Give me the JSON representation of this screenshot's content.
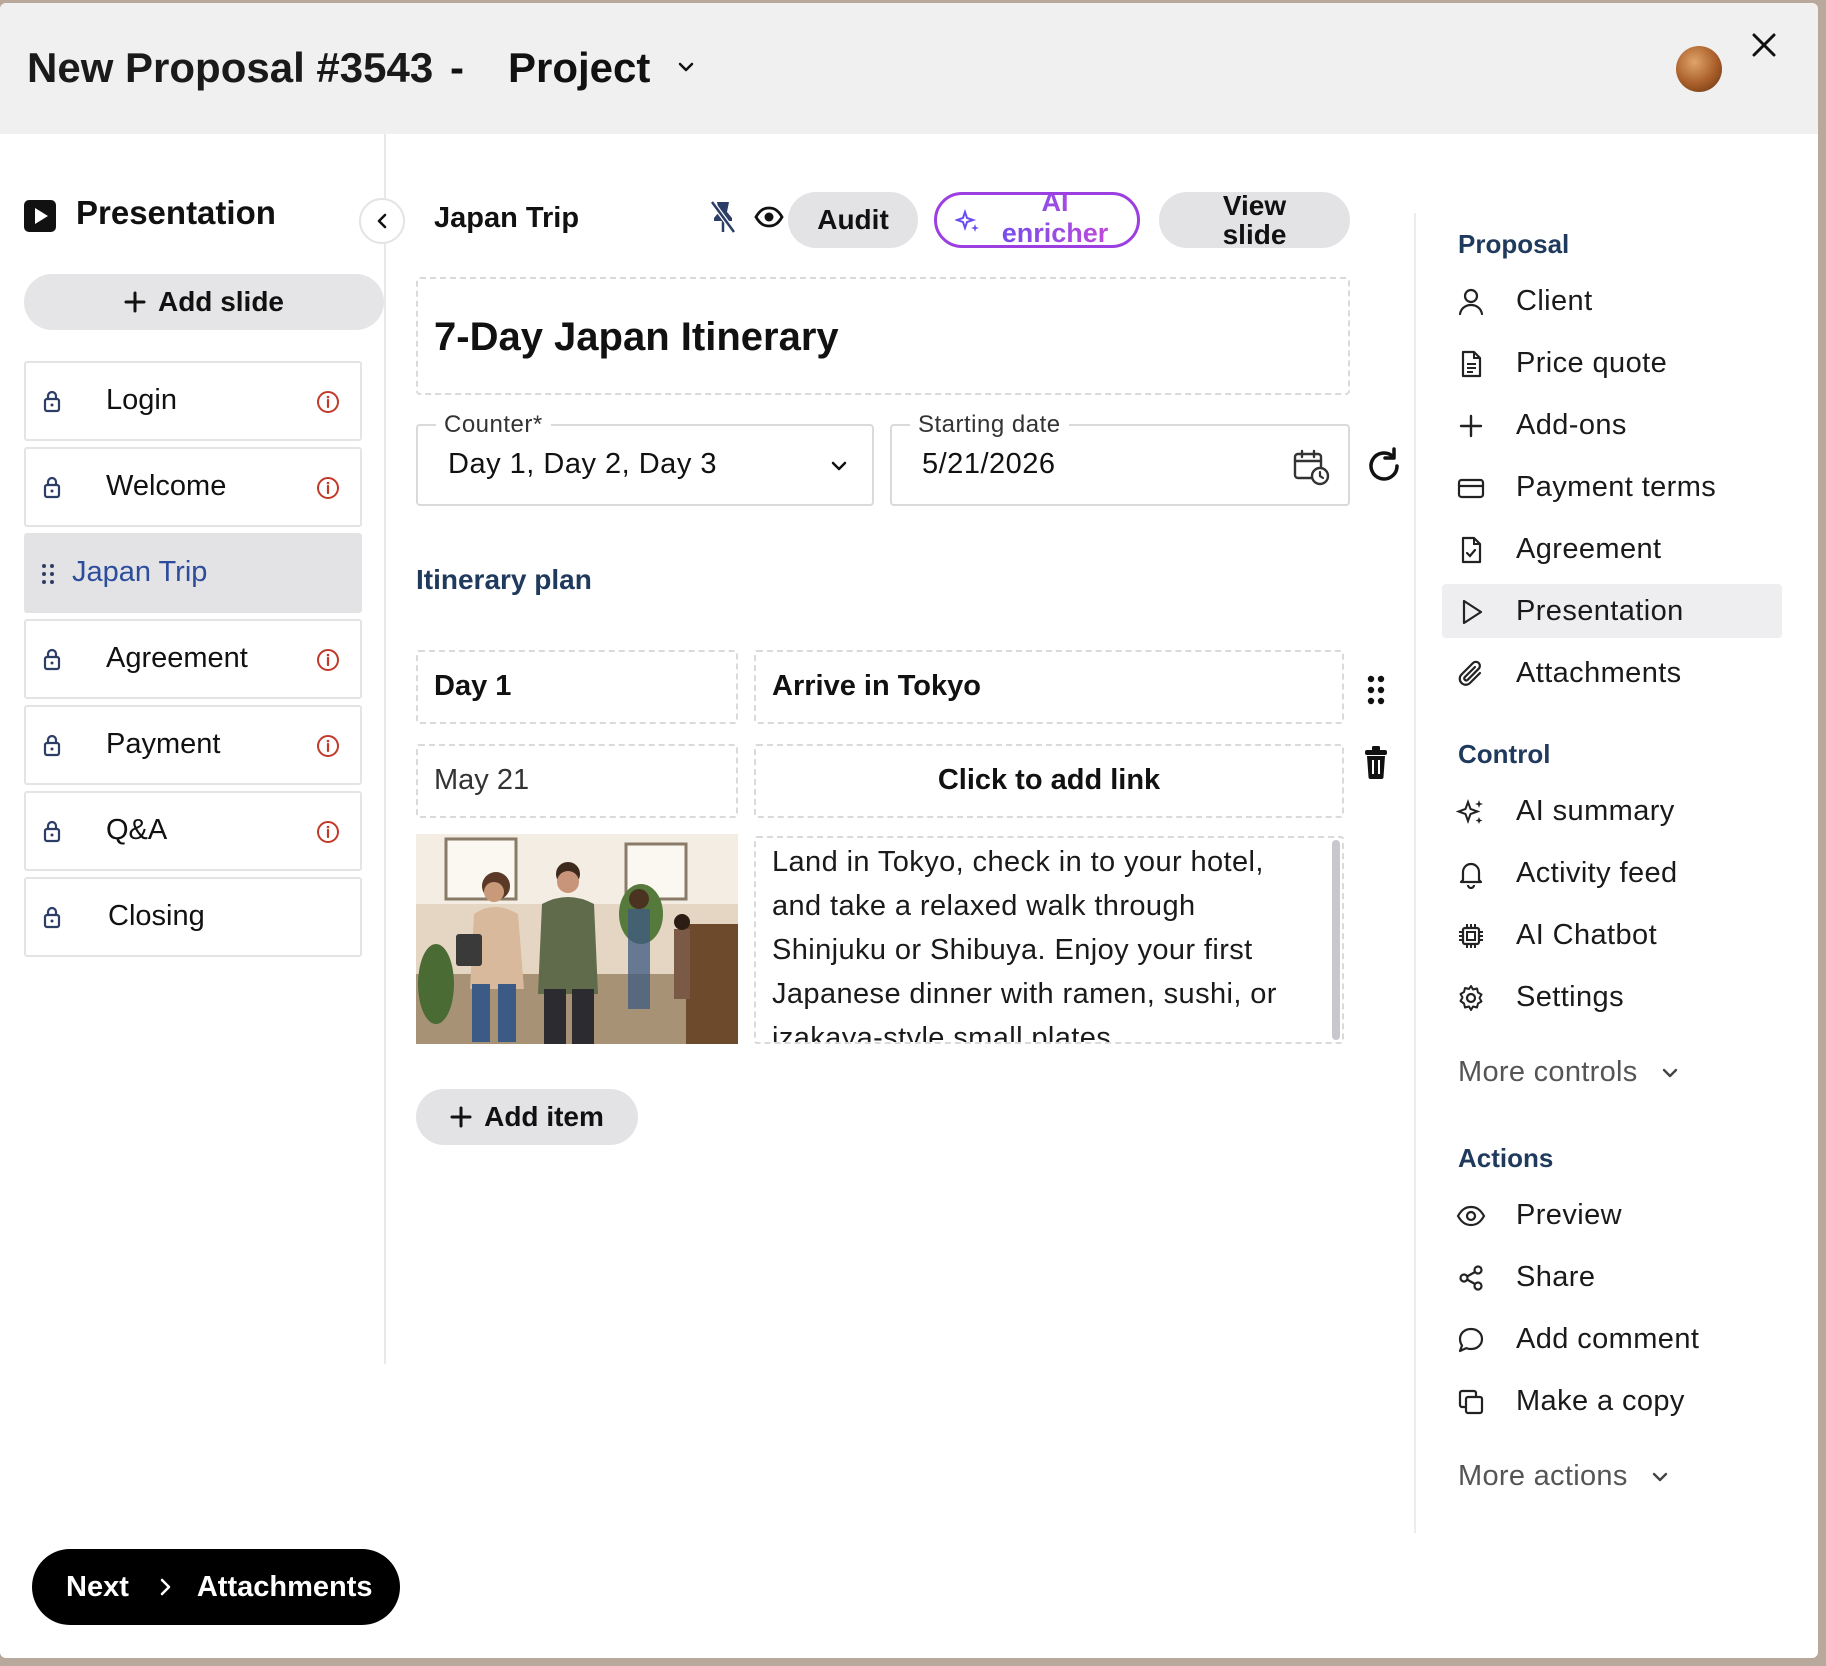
{
  "header": {
    "title": "New Proposal #3543",
    "separator": "-",
    "project_label": "Project"
  },
  "sidebar": {
    "title": "Presentation",
    "add_slide_label": "Add slide",
    "slides": [
      {
        "label": "Login",
        "locked": true,
        "has_info": true
      },
      {
        "label": "Welcome",
        "locked": true,
        "has_info": true
      },
      {
        "label": "Japan Trip",
        "locked": false,
        "has_info": false,
        "active": true
      },
      {
        "label": "Agreement",
        "locked": true,
        "has_info": true
      },
      {
        "label": "Payment",
        "locked": true,
        "has_info": true
      },
      {
        "label": "Q&A",
        "locked": true,
        "has_info": true
      },
      {
        "label": "Closing",
        "locked": true,
        "has_info": false
      }
    ],
    "next_label": "Next",
    "next_target": "Attachments"
  },
  "editor": {
    "slide_name": "Japan Trip",
    "audit_label": "Audit",
    "ai_label": "AI enricher",
    "view_label": "View slide",
    "title": "7-Day Japan Itinerary",
    "counter": {
      "label": "Counter*",
      "value": "Day 1, Day 2, Day 3"
    },
    "start_date": {
      "label": "Starting date",
      "value": "5/21/2026"
    },
    "section_label": "Itinerary plan",
    "item": {
      "day": "Day 1",
      "heading": "Arrive in Tokyo",
      "date": "May 21",
      "link_placeholder": "Click to add link",
      "description": "Land in Tokyo, check in to your hotel, and take a relaxed walk through Shinjuku or Shibuya. Enjoy your first Japanese dinner with ramen, sushi, or izakaya-style small plates."
    },
    "add_item_label": "Add item"
  },
  "right_panel": {
    "proposal_head": "Proposal",
    "proposal_items": [
      {
        "label": "Client",
        "icon": "user-icon"
      },
      {
        "label": "Price quote",
        "icon": "document-icon"
      },
      {
        "label": "Add-ons",
        "icon": "plus-icon"
      },
      {
        "label": "Payment terms",
        "icon": "card-icon"
      },
      {
        "label": "Agreement",
        "icon": "signed-document-icon"
      },
      {
        "label": "Presentation",
        "icon": "play-icon",
        "active": true
      },
      {
        "label": "Attachments",
        "icon": "paperclip-icon"
      }
    ],
    "control_head": "Control",
    "control_items": [
      {
        "label": "AI summary",
        "icon": "sparkles-icon"
      },
      {
        "label": "Activity feed",
        "icon": "bell-icon"
      },
      {
        "label": "AI Chatbot",
        "icon": "chip-icon"
      },
      {
        "label": "Settings",
        "icon": "gear-icon"
      }
    ],
    "more_controls": "More controls",
    "actions_head": "Actions",
    "action_items": [
      {
        "label": "Preview",
        "icon": "eye-icon"
      },
      {
        "label": "Share",
        "icon": "share-icon"
      },
      {
        "label": "Add comment",
        "icon": "comment-icon"
      },
      {
        "label": "Make a copy",
        "icon": "copy-icon"
      }
    ],
    "more_actions": "More actions"
  },
  "colors": {
    "accent_link": "#2d4d9c",
    "ai_gradient_start": "#6a4cf0",
    "ai_gradient_end": "#c94bd8",
    "info_red": "#c0392b",
    "section_label": "#1f3a5c"
  }
}
